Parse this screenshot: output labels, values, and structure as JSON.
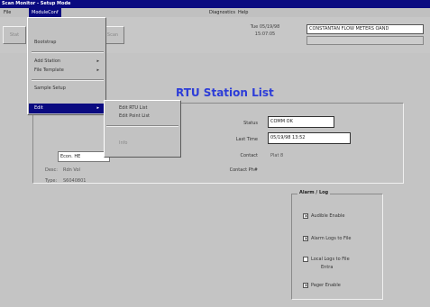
{
  "window": {
    "title": "Scan Monitor - Setup Mode"
  },
  "menubar": {
    "file": "File",
    "modules": "ModuleConf",
    "diagnostics": "Diagnostics",
    "help": "Help"
  },
  "toolbar": {
    "btn_left": "Stat",
    "btn_right": "Scan"
  },
  "clock": {
    "line1": "Tue 05/19/98",
    "line2": "15:07:05"
  },
  "station_header": {
    "value": "CONSTANTAN FLOW METERS OAND"
  },
  "page_title": "RTU Station List",
  "station": {
    "selector_value": "Econ. HE",
    "desc_label": "Desc:",
    "desc_value": "Rdn Vol",
    "type_label": "Type:",
    "type_value": "S6040801"
  },
  "fields": {
    "status_label": "Status",
    "status_value": "COMM OK",
    "lasttime_label": "Last Time",
    "lasttime_value": "05/19/98 13:52",
    "contact_label": "Contact",
    "contact_value": "Plat 8",
    "contactph_label": "Contact Ph#",
    "contactph_value": ""
  },
  "alarm_log": {
    "title": "Alarm / Log",
    "items": [
      {
        "label": "Audible Enable",
        "checked": true
      },
      {
        "label": "Alarm Logs to File",
        "checked": true
      },
      {
        "label": "Local Logs to File",
        "sublabel": "Entra",
        "checked": false
      },
      {
        "label": "Pager Enable",
        "checked": true
      }
    ]
  },
  "modules_menu": {
    "items": [
      {
        "label": "Bootstrap"
      },
      {
        "label": "Add Station",
        "arrow": "▸"
      },
      {
        "label": "File Template",
        "arrow": "▸"
      },
      {
        "label": "Sample Setup"
      },
      {
        "label": "Edit",
        "arrow": "▸"
      }
    ]
  },
  "edit_submenu": {
    "items": [
      {
        "label": "Edit RTU List"
      },
      {
        "label": "Edit Point List"
      },
      {
        "label": "Info"
      }
    ]
  }
}
